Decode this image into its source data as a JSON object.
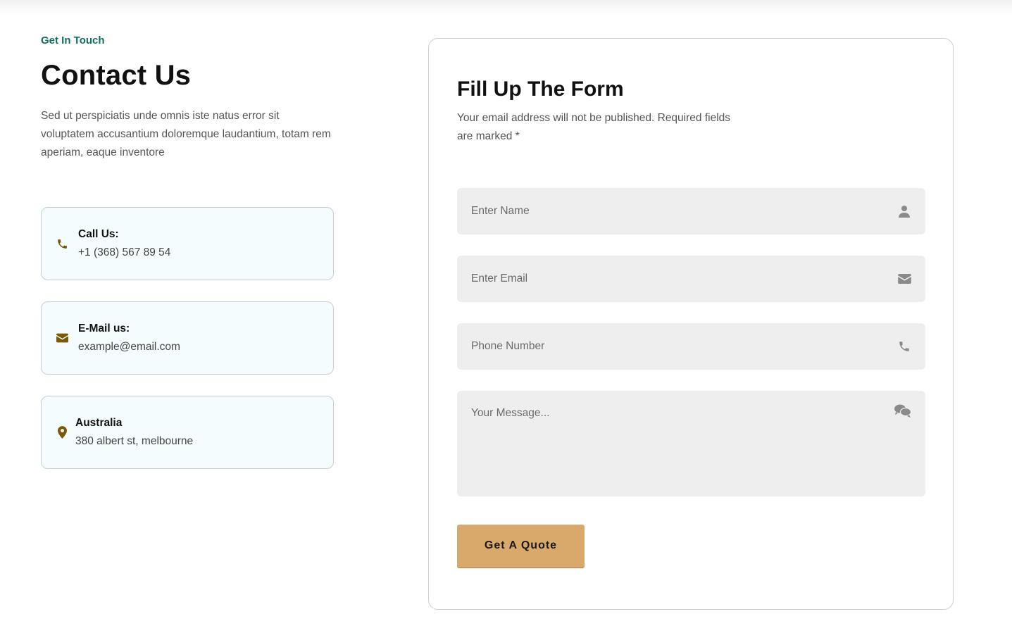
{
  "contact": {
    "eyebrow": "Get In Touch",
    "title": "Contact Us",
    "intro": "Sed ut perspiciatis unde omnis iste natus error sit voluptatem accusantium doloremque laudantium, totam rem aperiam, eaque inventore",
    "cards": [
      {
        "icon": "phone-icon",
        "label": "Call Us:",
        "value": "+1 (368) 567 89 54"
      },
      {
        "icon": "envelope-icon",
        "label": "E-Mail us:",
        "value": "example@email.com"
      },
      {
        "icon": "map-pin-icon",
        "label": "Australia",
        "value": "380 albert st, melbourne"
      }
    ]
  },
  "form": {
    "title": "Fill Up The Form",
    "subtitle": "Your email address will not be published. Required fields are marked *",
    "fields": {
      "name": {
        "placeholder": "Enter Name",
        "value": "",
        "icon": "user-icon"
      },
      "email": {
        "placeholder": "Enter Email",
        "value": "",
        "icon": "envelope-icon"
      },
      "phone": {
        "placeholder": "Phone Number",
        "value": "",
        "icon": "phone-icon"
      },
      "message": {
        "placeholder": "Your Message...",
        "value": "",
        "icon": "chat-bubbles-icon"
      }
    },
    "submit_label": "Get A Quote"
  },
  "colors": {
    "accent_green": "#0f6e5c",
    "icon_gold": "#7a5a06",
    "button_bg": "#d9a96b",
    "card_bg": "#f4fcfd",
    "field_bg": "#eeeeee"
  }
}
